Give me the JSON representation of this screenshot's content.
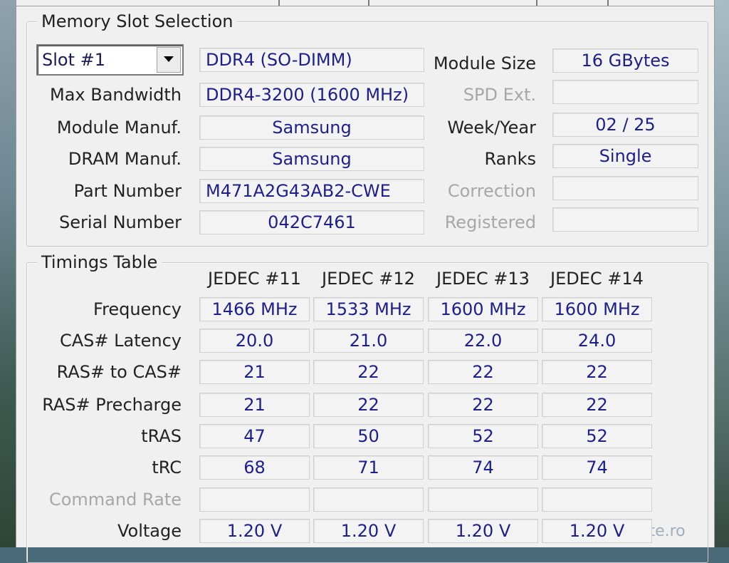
{
  "memory_slot_selection": {
    "title": "Memory Slot Selection",
    "slot": {
      "value": "Slot #1"
    },
    "module_type": "DDR4 (SO-DIMM)",
    "rows_left": [
      {
        "label": "Max Bandwidth",
        "value": "DDR4-3200 (1600 MHz)",
        "dim": false
      },
      {
        "label": "Module Manuf.",
        "value": "Samsung",
        "dim": false
      },
      {
        "label": "DRAM Manuf.",
        "value": "Samsung",
        "dim": false
      },
      {
        "label": "Part Number",
        "value": "M471A2G43AB2-CWE",
        "dim": false
      },
      {
        "label": "Serial Number",
        "value": "042C7461",
        "dim": false
      }
    ],
    "rows_right": [
      {
        "label": "Module Size",
        "value": "16 GBytes",
        "dim": false
      },
      {
        "label": "SPD Ext.",
        "value": "",
        "dim": true
      },
      {
        "label": "Week/Year",
        "value": "02 / 25",
        "dim": false
      },
      {
        "label": "Ranks",
        "value": "Single",
        "dim": false
      },
      {
        "label": "Correction",
        "value": "",
        "dim": true
      },
      {
        "label": "Registered",
        "value": "",
        "dim": true
      }
    ]
  },
  "timings_table": {
    "title": "Timings Table",
    "columns": [
      "JEDEC #11",
      "JEDEC #12",
      "JEDEC #13",
      "JEDEC #14"
    ],
    "rows": [
      {
        "label": "Frequency",
        "dim": false,
        "values": [
          "1466 MHz",
          "1533 MHz",
          "1600 MHz",
          "1600 MHz"
        ]
      },
      {
        "label": "CAS# Latency",
        "dim": false,
        "values": [
          "20.0",
          "21.0",
          "22.0",
          "24.0"
        ]
      },
      {
        "label": "RAS# to CAS#",
        "dim": false,
        "values": [
          "21",
          "22",
          "22",
          "22"
        ]
      },
      {
        "label": "RAS# Precharge",
        "dim": false,
        "values": [
          "21",
          "22",
          "22",
          "22"
        ]
      },
      {
        "label": "tRAS",
        "dim": false,
        "values": [
          "47",
          "50",
          "52",
          "52"
        ]
      },
      {
        "label": "tRC",
        "dim": false,
        "values": [
          "68",
          "71",
          "74",
          "74"
        ]
      },
      {
        "label": "Command Rate",
        "dim": true,
        "values": [
          "",
          "",
          "",
          ""
        ]
      },
      {
        "label": "Voltage",
        "dim": false,
        "values": [
          "1.20 V",
          "1.20 V",
          "1.20 V",
          "1.20 V"
        ]
      }
    ]
  },
  "watermark": "ajumate.ro",
  "colors": {
    "value_text": "#1e1e8c",
    "disabled_text": "#a7a7a7",
    "panel_bg": "#f0f0f0"
  }
}
